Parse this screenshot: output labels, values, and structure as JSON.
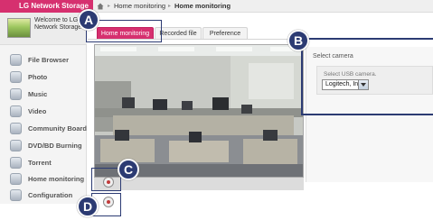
{
  "header": {
    "brand": "LG Network Storage",
    "breadcrumb": [
      "Home monitoring",
      "Home monitoring"
    ]
  },
  "sidebar": {
    "welcome": "Welcome to LG Network Storage",
    "items": [
      {
        "label": "File Browser",
        "icon": "folder-icon"
      },
      {
        "label": "Photo",
        "icon": "photo-icon"
      },
      {
        "label": "Music",
        "icon": "music-icon"
      },
      {
        "label": "Video",
        "icon": "video-icon"
      },
      {
        "label": "Community Board",
        "icon": "board-icon"
      },
      {
        "label": "DVD/BD Burning",
        "icon": "disc-icon"
      },
      {
        "label": "Torrent",
        "icon": "torrent-icon"
      },
      {
        "label": "Home monitoring",
        "icon": "monitoring-icon"
      },
      {
        "label": "Configuration",
        "icon": "gear-icon"
      }
    ]
  },
  "tabs": [
    "Home monitoring",
    "Recorded file",
    "Preference"
  ],
  "active_tab": "Home monitoring",
  "camera": {
    "controls": [
      "record-button",
      "snapshot-button"
    ]
  },
  "panel": {
    "title": "Select camera",
    "select_label": "Select USB camera.",
    "selected_camera": "Logitech, Inc."
  },
  "callouts": [
    "A",
    "B",
    "C",
    "D"
  ],
  "colors": {
    "brand": "#d6306f",
    "callout": "#2c3b73"
  }
}
